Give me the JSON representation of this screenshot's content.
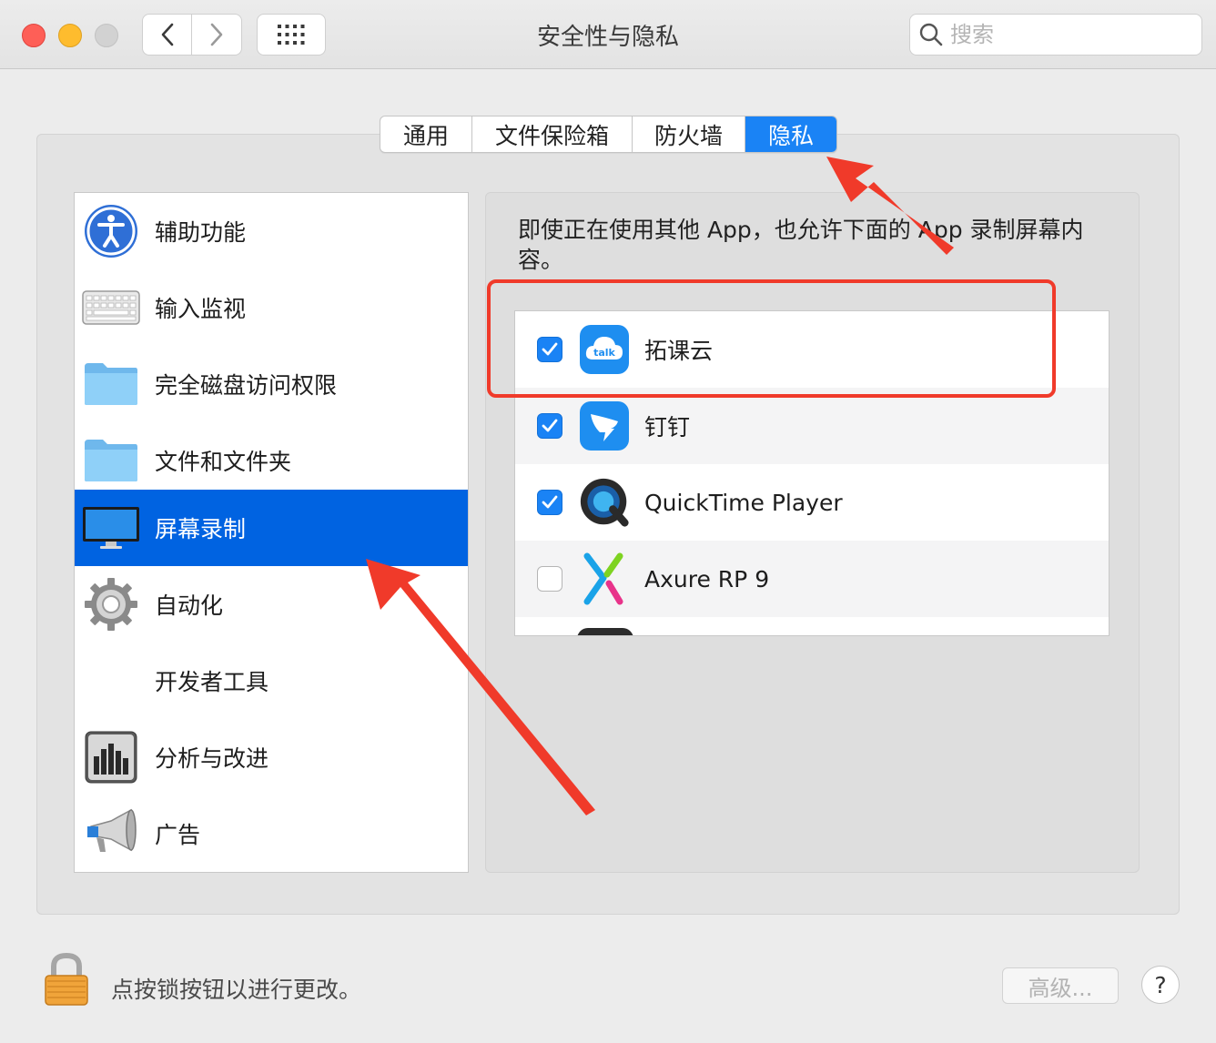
{
  "window": {
    "title": "安全性与隐私"
  },
  "search": {
    "placeholder": "搜索"
  },
  "tabs": [
    {
      "label": "通用"
    },
    {
      "label": "文件保险箱"
    },
    {
      "label": "防火墙"
    },
    {
      "label": "隐私",
      "active": true
    }
  ],
  "sidebar": {
    "items": [
      {
        "label": "辅助功能",
        "icon": "accessibility-icon"
      },
      {
        "label": "输入监视",
        "icon": "keyboard-icon"
      },
      {
        "label": "完全磁盘访问权限",
        "icon": "folder-icon"
      },
      {
        "label": "文件和文件夹",
        "icon": "folder-icon"
      },
      {
        "label": "屏幕录制",
        "icon": "monitor-icon",
        "selected": true
      },
      {
        "label": "自动化",
        "icon": "gear-icon"
      },
      {
        "label": "开发者工具",
        "icon": ""
      },
      {
        "label": "分析与改进",
        "icon": "bar-chart-icon"
      },
      {
        "label": "广告",
        "icon": "megaphone-icon"
      }
    ]
  },
  "main": {
    "description": "即使正在使用其他 App，也允许下面的 App 录制屏幕内容。",
    "apps": [
      {
        "name": "拓课云",
        "checked": true,
        "icon": "talk-cloud-icon"
      },
      {
        "name": "钉钉",
        "checked": true,
        "icon": "dingtalk-icon"
      },
      {
        "name": "QuickTime Player",
        "checked": true,
        "icon": "quicktime-icon"
      },
      {
        "name": "Axure RP 9",
        "checked": false,
        "icon": "axure-icon"
      }
    ]
  },
  "footer": {
    "lock_message": "点按锁按钮以进行更改。",
    "advanced_label": "高级...",
    "help_label": "?"
  },
  "colors": {
    "accent": "#1a83f5",
    "selection": "#0063e1",
    "annotation": "#f03a2a"
  }
}
